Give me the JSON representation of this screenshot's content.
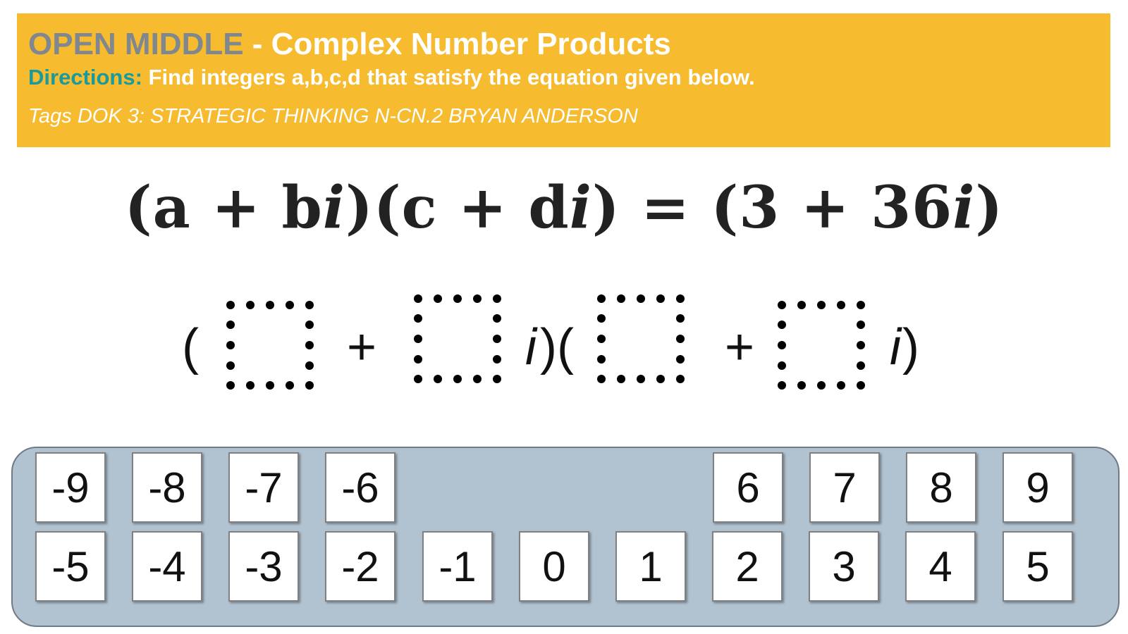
{
  "header": {
    "brand": "OPEN MIDDLE",
    "title_rest": " - Complex Number Products",
    "directions_label": "Directions:",
    "directions_text": " Find integers a,b,c,d that satisfy the equation given below.",
    "tags": "Tags DOK 3: STRATEGIC THINKING N-CN.2  BRYAN ANDERSON"
  },
  "equation": {
    "p1": "(a + b",
    "i1": "i",
    "p2": ")(c + d",
    "i2": "i",
    "p3": ") = (3 + 36",
    "i3": "i",
    "p4": ")"
  },
  "template": {
    "open1": "(",
    "plus1": "+",
    "i_close_open": "i",
    "paren_mid": ")(",
    "plus2": "+",
    "i_close": "i",
    "close": ")"
  },
  "tiles": {
    "top_row": [
      "-9",
      "-8",
      "-7",
      "-6",
      "6",
      "7",
      "8",
      "9"
    ],
    "bottom_row": [
      "-5",
      "-4",
      "-3",
      "-2",
      "-1",
      "0",
      "1",
      "2",
      "3",
      "4",
      "5"
    ]
  },
  "colors": {
    "header_bg": "#f6bb2f",
    "brand": "#7f8790",
    "directions_label": "#1a9a9a",
    "tray_bg": "#b1c2d0"
  }
}
